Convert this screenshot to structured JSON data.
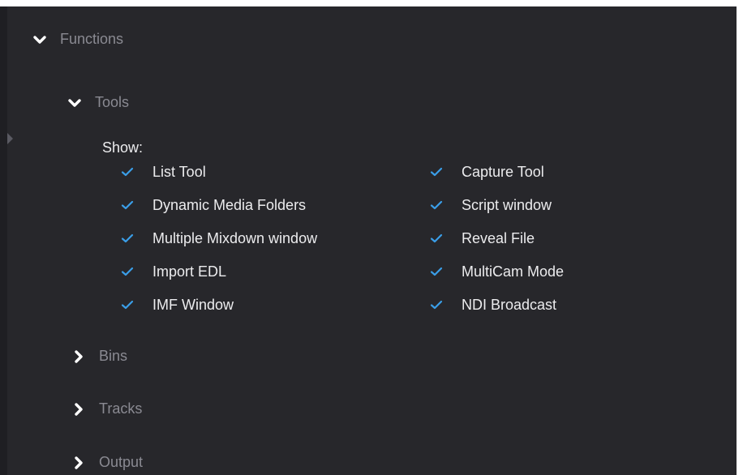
{
  "colors": {
    "panel_bg": "#27272b",
    "section_text": "#8a8a92",
    "option_text": "#ececee",
    "check_accent": "#3a9ee8"
  },
  "sections": {
    "functions": {
      "label": "Functions",
      "icon": "chevron-down-icon",
      "expanded": true
    },
    "tools": {
      "label": "Tools",
      "icon": "chevron-down-icon",
      "expanded": true
    },
    "bins": {
      "label": "Bins",
      "icon": "chevron-right-icon",
      "expanded": false
    },
    "tracks": {
      "label": "Tracks",
      "icon": "chevron-right-icon",
      "expanded": false
    },
    "output": {
      "label": "Output",
      "icon": "chevron-right-icon",
      "expanded": false
    }
  },
  "tools": {
    "show_label": "Show:",
    "left_options": [
      {
        "label": "List Tool",
        "checked": true
      },
      {
        "label": "Dynamic Media Folders",
        "checked": true
      },
      {
        "label": "Multiple Mixdown window",
        "checked": true
      },
      {
        "label": "Import EDL",
        "checked": true
      },
      {
        "label": "IMF Window",
        "checked": true
      }
    ],
    "right_options": [
      {
        "label": "Capture Tool",
        "checked": true
      },
      {
        "label": "Script window",
        "checked": true
      },
      {
        "label": "Reveal File",
        "checked": true
      },
      {
        "label": "MultiCam Mode",
        "checked": true
      },
      {
        "label": "NDI Broadcast",
        "checked": true
      }
    ]
  }
}
